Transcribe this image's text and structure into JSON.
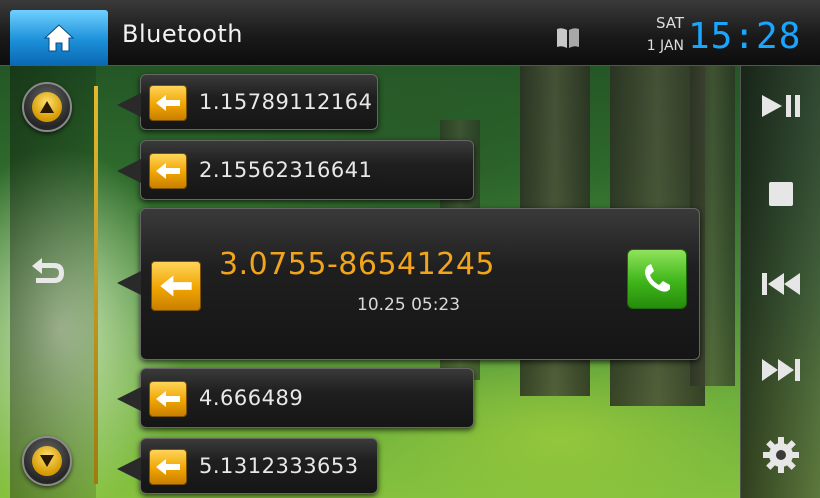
{
  "header": {
    "title": "Bluetooth",
    "day": "SAT",
    "date": "1 JAN",
    "time": "15:28",
    "home_icon": "home-icon",
    "phonebook_icon": "book-icon"
  },
  "left_controls": {
    "up_icon": "arrow-up-icon",
    "back_icon": "back-icon",
    "down_icon": "arrow-down-icon"
  },
  "right_controls": {
    "play_pause_icon": "play-pause-icon",
    "stop_icon": "stop-icon",
    "previous_icon": "previous-track-icon",
    "next_icon": "next-track-icon",
    "settings_icon": "gear-icon"
  },
  "call_log": [
    {
      "label": "1.15789112164"
    },
    {
      "label": "2.15562316641"
    },
    {
      "label": "3.0755-86541245",
      "time": "10.25 05:23",
      "selected": true
    },
    {
      "label": "4.666489"
    },
    {
      "label": "5.1312333653"
    }
  ],
  "colors": {
    "accent_blue": "#1aa6ff",
    "selected_number": "#f2a51a",
    "badge_orange": "#f0a400",
    "call_green": "#3fb51a"
  }
}
